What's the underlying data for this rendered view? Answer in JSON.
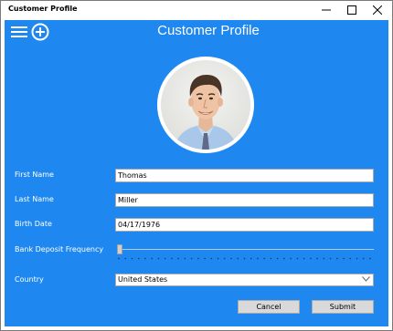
{
  "window": {
    "title": "Customer Profile"
  },
  "header": {
    "title": "Customer Profile"
  },
  "form": {
    "first_name": {
      "label": "First Name",
      "value": "Thomas"
    },
    "last_name": {
      "label": "Last Name",
      "value": "Miller"
    },
    "birth_date": {
      "label": "Birth Date",
      "value": "04/17/1976"
    },
    "deposit_frequency": {
      "label": "Bank Deposit Frequency",
      "value_fraction": 0.0
    },
    "country": {
      "label": "Country",
      "value": "United States"
    }
  },
  "actions": {
    "cancel": "Cancel",
    "submit": "Submit"
  },
  "colors": {
    "accent": "#1f88f0",
    "field_bg": "#ffffff",
    "button_bg": "#d9d9d9"
  },
  "icons": {
    "menu": "hamburger-icon",
    "add": "add-circle-icon",
    "minimize": "minimize-icon",
    "maximize": "maximize-icon",
    "close": "close-icon",
    "dropdown": "chevron-down-icon"
  }
}
